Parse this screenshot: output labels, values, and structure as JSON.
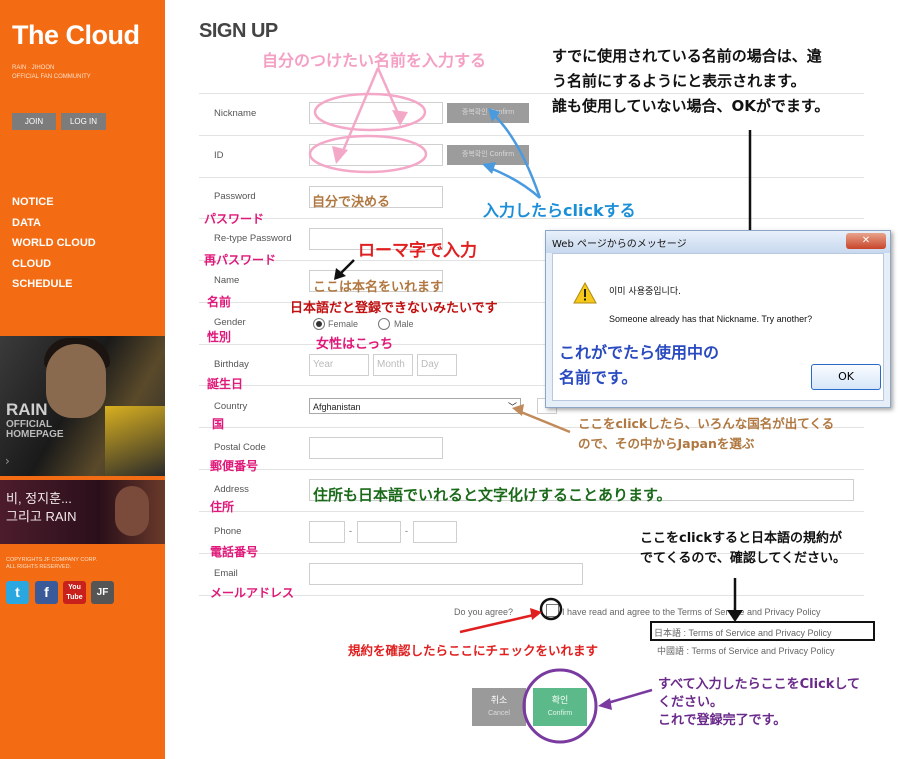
{
  "sidebar": {
    "logo": "The Cloud",
    "tagline_1": "RAIN · JIHOON",
    "tagline_2": "OFFICIAL FAN COMMUNITY",
    "join": "JOIN",
    "login": "LOG IN",
    "nav": [
      "NOTICE",
      "DATA",
      "WORLD CLOUD",
      "CLOUD",
      "SCHEDULE"
    ],
    "banner1_t1": "RAIN",
    "banner1_t2a": "OFFICIAL",
    "banner1_t2b": "HOMEPAGE",
    "banner2_a": "비, 정지훈...",
    "banner2_b": "그리고 RAIN",
    "copyright_1": "COPYRIGHTS JF COMPANY CORP.",
    "copyright_2": "ALL RIGHTS RESERVED.",
    "social": [
      "t",
      "f",
      "You Tube",
      "JF"
    ]
  },
  "form": {
    "title": "SIGN UP",
    "nickname": "Nickname",
    "id": "ID",
    "password": "Password",
    "retype": "Re-type Password",
    "name": "Name",
    "gender": "Gender",
    "female": "Female",
    "male": "Male",
    "birthday": "Birthday",
    "year": "Year",
    "month": "Month",
    "day": "Day",
    "country": "Country",
    "country_value": "Afghanistan",
    "postal": "Postal Code",
    "address": "Address",
    "phone": "Phone",
    "dash": "-",
    "email": "Email",
    "check_btn_ko": "중복확인",
    "check_btn_en": "Confirm",
    "agree_a": "Do you agree?",
    "agree_b": "I have read and agree to the Terms of Service and Privacy Policy",
    "terms_jp": "日本語 : Terms of Service and Privacy Policy",
    "terms_cn": "中國語 : Terms of Service and Privacy Policy",
    "cancel_ko": "취소",
    "cancel_en": "Cancel",
    "confirm_ko": "확인",
    "confirm_en": "Confirm"
  },
  "dialog": {
    "title": "Web ページからのメッセージ",
    "close": "✕",
    "line_ko": "이미 사용중입니다.",
    "line_en": "Someone already has that Nickname. Try another?",
    "ok": "OK"
  },
  "annotations": {
    "name_hint": "自分のつけたい名前を入力する",
    "used_hint_1": "すでに使用されている名前の場合は、違",
    "used_hint_2": "う名前にするようにと表示されます。",
    "used_hint_3": "誰も使用していない場合、OKがでます。",
    "click_hint": "入力したらclickする",
    "self_decide": "自分で決める",
    "password_jp": "パスワード",
    "retype_jp": "再パスワード",
    "romaji": "ローマ字で入力",
    "real_name": "ここは本名をいれます",
    "name_jp": "名前",
    "no_japanese": "日本語だと登録できないみたいです",
    "gender_jp": "性別",
    "female_here": "女性はこっち",
    "in_use": "これがでたら使用中の",
    "in_use_2": "名前です。",
    "birthday_jp": "誕生日",
    "country_jp": "国",
    "country_hint_1": "ここをclickしたら、いろんな国名が出てくる",
    "country_hint_2": "ので、その中からJapanを選ぶ",
    "postal_jp": "郵便番号",
    "address_hint": "住所も日本語でいれると文字化けすることあります。",
    "address_jp": "住所",
    "phone_jp": "電話番号",
    "terms_hint_1": "ここをclickすると日本語の規約が",
    "terms_hint_2": "でてくるので、確認してください。",
    "email_jp": "メールアドレス",
    "check_hint": "規約を確認したらここにチェックをいれます",
    "final_1": "すべて入力したらここをClickして",
    "final_2": "ください。",
    "final_3": "これで登録完了です。"
  },
  "colors": {
    "sidebar_orange": "#f36b12",
    "pink": "#e0187a",
    "blue": "#1a8fd8",
    "red": "#e02020",
    "brown": "#b07840",
    "green": "#1a6a1a",
    "purple": "#6a2a8a",
    "confirm_green": "#5cba8a"
  }
}
